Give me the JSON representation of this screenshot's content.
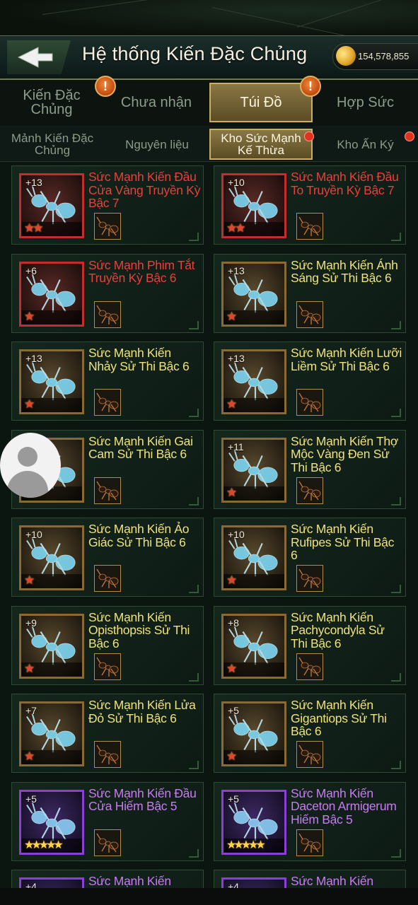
{
  "header": {
    "title": "Hệ thống Kiến Đặc Chủng",
    "currency_value": "154,578,855"
  },
  "tabs_primary": [
    {
      "label": "Kiến Đặc Chủng",
      "active": false,
      "alert": false
    },
    {
      "label": "Chưa nhận",
      "active": false,
      "alert": true
    },
    {
      "label": "Túi Đồ",
      "active": true,
      "alert": true
    },
    {
      "label": "Hợp Sức",
      "active": false,
      "alert": false
    }
  ],
  "tabs_secondary": [
    {
      "label": "Mảnh Kiến Đặc Chủng",
      "active": false,
      "dot": false
    },
    {
      "label": "Nguyên liệu",
      "active": false,
      "dot": false
    },
    {
      "label": "Kho Sức Mạnh Kế Thừa",
      "active": true,
      "dot": true
    },
    {
      "label": "Kho Ấn Ký",
      "active": false,
      "dot": true
    }
  ],
  "alert_symbol": "!",
  "star_glyph": "★",
  "items": [
    {
      "level": "+13",
      "stars": 2,
      "rarity": "red",
      "name": "Sức Mạnh Kiến Đầu Cửa Vàng Truyền Kỳ Bậc 7"
    },
    {
      "level": "+10",
      "stars": 2,
      "rarity": "red",
      "name": "Sức Mạnh Kiến Đầu To Truyền Kỳ Bậc 7"
    },
    {
      "level": "+6",
      "stars": 1,
      "rarity": "red",
      "name": "Sức Mạnh Phim Tắt Truyền Kỳ Bậc 6"
    },
    {
      "level": "+13",
      "stars": 1,
      "rarity": "yellow",
      "name": "Sức Mạnh Kiến Ánh Sáng Sử Thi Bậc 6"
    },
    {
      "level": "+13",
      "stars": 1,
      "rarity": "yellow",
      "name": "Sức Mạnh Kiến Nhảy Sử Thi Bậc 6"
    },
    {
      "level": "+13",
      "stars": 1,
      "rarity": "yellow",
      "name": "Sức Mạnh Kiến Lưỡi Liềm Sử Thi Bậc 6"
    },
    {
      "level": "",
      "stars": 1,
      "rarity": "yellow",
      "name": "Sức Mạnh Kiến Gai Cam Sử Thi Bậc 6"
    },
    {
      "level": "+11",
      "stars": 1,
      "rarity": "yellow",
      "name": "Sức Mạnh Kiến Thợ Mộc Vàng Đen Sử Thi Bậc 6"
    },
    {
      "level": "+10",
      "stars": 1,
      "rarity": "yellow",
      "name": "Sức Mạnh Kiến Ảo Giác Sử Thi Bậc 6"
    },
    {
      "level": "+10",
      "stars": 1,
      "rarity": "yellow",
      "name": "Sức Mạnh Kiến Rufipes Sử Thi Bậc 6"
    },
    {
      "level": "+9",
      "stars": 1,
      "rarity": "yellow",
      "name": "Sức Mạnh Kiến Opisthopsis Sử Thi Bậc 6"
    },
    {
      "level": "+8",
      "stars": 1,
      "rarity": "yellow",
      "name": "Sức Mạnh Kiến Pachycondyla Sử Thi Bậc 6"
    },
    {
      "level": "+7",
      "stars": 1,
      "rarity": "yellow",
      "name": "Sức Mạnh Kiến Lửa Đỏ Sử Thi Bậc 6"
    },
    {
      "level": "+5",
      "stars": 1,
      "rarity": "yellow",
      "name": "Sức Mạnh Kiến Gigantiops Sử Thi Bậc 6"
    },
    {
      "level": "+5",
      "stars": 5,
      "rarity": "purple",
      "name": "Sức Mạnh Kiến Đầu Cửa Hiếm Bậc 5"
    },
    {
      "level": "+5",
      "stars": 5,
      "rarity": "purple",
      "name": "Sức Mạnh Kiến Daceton Armigerum Hiếm Bậc 5"
    },
    {
      "level": "+4",
      "stars": 0,
      "rarity": "purple",
      "name": "Sức Mạnh Kiến"
    },
    {
      "level": "+4",
      "stars": 0,
      "rarity": "purple",
      "name": "Sức Mạnh Kiến"
    }
  ],
  "icons": {
    "back": "back-arrow-icon",
    "currency": "gold-nugget-icon",
    "alert": "exclamation-alert-icon",
    "avatar": "user-avatar-icon"
  },
  "colors": {
    "legendary_text": "#e8403a",
    "epic_text": "#efe27a",
    "rare_text": "#c77bf0",
    "active_tab": "#8a7745",
    "star_red": "#e2452c",
    "star_gold": "#ffd54a"
  }
}
